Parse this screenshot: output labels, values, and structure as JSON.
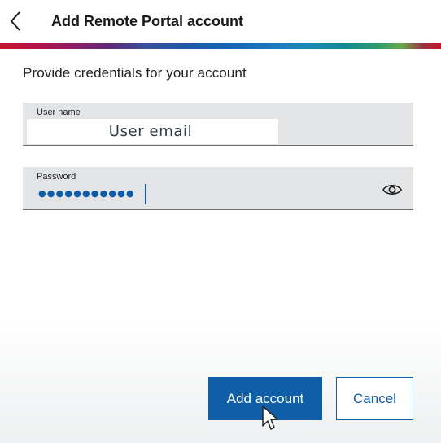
{
  "header": {
    "title": "Add Remote Portal account",
    "back_icon": "chevron-left-icon"
  },
  "form": {
    "subtitle": "Provide credentials for your account",
    "username": {
      "label": "User name",
      "value": "User email"
    },
    "password": {
      "label": "Password",
      "masked_value": "●●●●●●●●●●●",
      "toggle_icon": "eye-icon"
    }
  },
  "actions": {
    "primary_label": "Add account",
    "secondary_label": "Cancel"
  },
  "colors": {
    "accent": "#0f5ea8",
    "field_bg": "#e3e4e6",
    "brand_red": "#c4162e"
  }
}
